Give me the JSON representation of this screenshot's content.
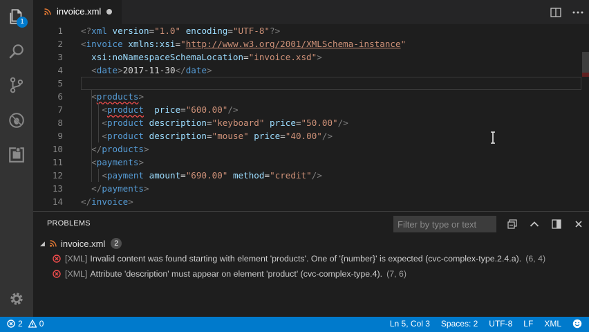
{
  "activity": {
    "source_control_badge": "1"
  },
  "tab": {
    "title": "invoice.xml"
  },
  "editor": {
    "lines": [
      {
        "n": "1",
        "segments": [
          [
            "p",
            "<?"
          ],
          [
            "t",
            "xml"
          ],
          [
            "c",
            " "
          ],
          [
            "a",
            "version"
          ],
          [
            "c",
            "="
          ],
          [
            "s",
            "\"1.0\""
          ],
          [
            "c",
            " "
          ],
          [
            "a",
            "encoding"
          ],
          [
            "c",
            "="
          ],
          [
            "s",
            "\"UTF-8\""
          ],
          [
            "p",
            "?>"
          ]
        ]
      },
      {
        "n": "2",
        "segments": [
          [
            "p",
            "<"
          ],
          [
            "t",
            "invoice"
          ],
          [
            "c",
            " "
          ],
          [
            "a",
            "xmlns:xsi"
          ],
          [
            "c",
            "="
          ],
          [
            "s",
            "\""
          ],
          [
            "l",
            "http://www.w3.org/2001/XMLSchema-instance"
          ],
          [
            "s",
            "\""
          ]
        ]
      },
      {
        "n": "3",
        "segments": [
          [
            "c",
            "  "
          ],
          [
            "a",
            "xsi:noNamespaceSchemaLocation"
          ],
          [
            "c",
            "="
          ],
          [
            "s",
            "\"invoice.xsd\""
          ],
          [
            "p",
            ">"
          ]
        ]
      },
      {
        "n": "4",
        "segments": [
          [
            "c",
            "  "
          ],
          [
            "p",
            "<"
          ],
          [
            "t",
            "date"
          ],
          [
            "p",
            ">"
          ],
          [
            "c",
            "2017-11-30"
          ],
          [
            "p",
            "</"
          ],
          [
            "t",
            "date"
          ],
          [
            "p",
            ">"
          ]
        ]
      },
      {
        "n": "5",
        "segments": []
      },
      {
        "n": "6",
        "segments": [
          [
            "c",
            "  "
          ],
          [
            "p",
            "<"
          ],
          [
            "tq",
            "products"
          ],
          [
            "p",
            ">"
          ]
        ]
      },
      {
        "n": "7",
        "segments": [
          [
            "c",
            "    "
          ],
          [
            "p",
            "<"
          ],
          [
            "tq",
            "product"
          ],
          [
            "c",
            "  "
          ],
          [
            "a",
            "price"
          ],
          [
            "c",
            "="
          ],
          [
            "s",
            "\"600.00\""
          ],
          [
            "p",
            "/>"
          ]
        ]
      },
      {
        "n": "8",
        "segments": [
          [
            "c",
            "    "
          ],
          [
            "p",
            "<"
          ],
          [
            "t",
            "product"
          ],
          [
            "c",
            " "
          ],
          [
            "a",
            "description"
          ],
          [
            "c",
            "="
          ],
          [
            "s",
            "\"keyboard\""
          ],
          [
            "c",
            " "
          ],
          [
            "a",
            "price"
          ],
          [
            "c",
            "="
          ],
          [
            "s",
            "\"50.00\""
          ],
          [
            "p",
            "/>"
          ]
        ]
      },
      {
        "n": "9",
        "segments": [
          [
            "c",
            "    "
          ],
          [
            "p",
            "<"
          ],
          [
            "t",
            "product"
          ],
          [
            "c",
            " "
          ],
          [
            "a",
            "description"
          ],
          [
            "c",
            "="
          ],
          [
            "s",
            "\"mouse\""
          ],
          [
            "c",
            " "
          ],
          [
            "a",
            "price"
          ],
          [
            "c",
            "="
          ],
          [
            "s",
            "\"40.00\""
          ],
          [
            "p",
            "/>"
          ]
        ]
      },
      {
        "n": "10",
        "segments": [
          [
            "c",
            "  "
          ],
          [
            "p",
            "</"
          ],
          [
            "t",
            "products"
          ],
          [
            "p",
            ">"
          ]
        ]
      },
      {
        "n": "11",
        "segments": [
          [
            "c",
            "  "
          ],
          [
            "p",
            "<"
          ],
          [
            "t",
            "payments"
          ],
          [
            "p",
            ">"
          ]
        ]
      },
      {
        "n": "12",
        "segments": [
          [
            "c",
            "    "
          ],
          [
            "p",
            "<"
          ],
          [
            "t",
            "payment"
          ],
          [
            "c",
            " "
          ],
          [
            "a",
            "amount"
          ],
          [
            "c",
            "="
          ],
          [
            "s",
            "\"690.00\""
          ],
          [
            "c",
            " "
          ],
          [
            "a",
            "method"
          ],
          [
            "c",
            "="
          ],
          [
            "s",
            "\"credit\""
          ],
          [
            "p",
            "/>"
          ]
        ]
      },
      {
        "n": "13",
        "segments": [
          [
            "c",
            "  "
          ],
          [
            "p",
            "</"
          ],
          [
            "t",
            "payments"
          ],
          [
            "p",
            ">"
          ]
        ]
      },
      {
        "n": "14",
        "segments": [
          [
            "p",
            "</"
          ],
          [
            "t",
            "invoice"
          ],
          [
            "p",
            ">"
          ]
        ]
      }
    ]
  },
  "panel": {
    "title": "PROBLEMS",
    "filter_placeholder": "Filter by type or text",
    "file": {
      "name": "invoice.xml",
      "count": "2"
    },
    "problems": [
      {
        "source": "[XML]",
        "message": "Invalid content was found starting with element 'products'. One of '{number}' is expected (cvc-complex-type.2.4.a).",
        "position": "(6, 4)"
      },
      {
        "source": "[XML]",
        "message": "Attribute 'description' must appear on element 'product' (cvc-complex-type.4).",
        "position": "(7, 6)"
      }
    ]
  },
  "status": {
    "errors": "2",
    "warnings": "0",
    "cursor": "Ln 5, Col 3",
    "spaces": "Spaces: 2",
    "encoding": "UTF-8",
    "eol": "LF",
    "language": "XML"
  },
  "colors": {
    "accent": "#007acc",
    "error": "#f14c4c",
    "editor_bg": "#1e1e1e"
  }
}
